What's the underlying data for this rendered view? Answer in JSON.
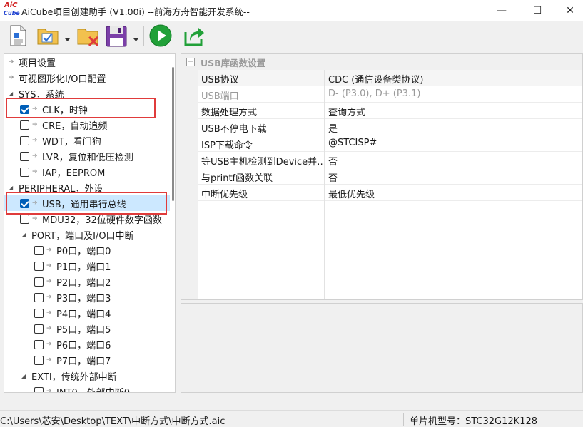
{
  "window": {
    "logo_top": "AiC",
    "logo_bottom": "Cube",
    "title": "AiCube项目创建助手 (V1.00i) --前海方舟智能开发系统--",
    "min_glyph": "—",
    "max_glyph": "☐",
    "close_glyph": "✕"
  },
  "toolbar": {
    "buttons": [
      "new-project",
      "open-config",
      "delete",
      "save",
      "run",
      "export"
    ]
  },
  "tree": {
    "items": [
      {
        "label": "项目设置"
      },
      {
        "label": "可视图形化I/O口配置"
      },
      {
        "label": "SYS，系统"
      },
      {
        "label": "CLK，时钟",
        "checked": true
      },
      {
        "label": "CRE，自动追频",
        "checked": false
      },
      {
        "label": "WDT，看门狗",
        "checked": false
      },
      {
        "label": "LVR，复位和低压检测",
        "checked": false
      },
      {
        "label": "IAP，EEPROM",
        "checked": false
      },
      {
        "label": "PERIPHERAL，外设"
      },
      {
        "label": "USB，通用串行总线",
        "checked": true
      },
      {
        "label": "MDU32，32位硬件数字函数",
        "checked": false
      },
      {
        "label": "PORT，端口及I/O口中断"
      },
      {
        "label": "P0口，端口0",
        "checked": false
      },
      {
        "label": "P1口，端口1",
        "checked": false
      },
      {
        "label": "P2口，端口2",
        "checked": false
      },
      {
        "label": "P3口，端口3",
        "checked": false
      },
      {
        "label": "P4口，端口4",
        "checked": false
      },
      {
        "label": "P5口，端口5",
        "checked": false
      },
      {
        "label": "P6口，端口6",
        "checked": false
      },
      {
        "label": "P7口，端口7",
        "checked": false
      },
      {
        "label": "EXTI，传统外部中断"
      },
      {
        "label": "INT0，外部中断0",
        "checked": false
      }
    ]
  },
  "props": {
    "category": "USB库函数设置",
    "rows": [
      {
        "key": "USB协议",
        "value": "CDC (通信设备类协议)"
      },
      {
        "key": "USB端口",
        "value": "D- (P3.0), D+ (P3.1)"
      },
      {
        "key": "数据处理方式",
        "value": "查询方式"
      },
      {
        "key": "USB不停电下载",
        "value": "是"
      },
      {
        "key": "ISP下载命令",
        "value": "@STCISP#"
      },
      {
        "key": "等USB主机检测到Device并…",
        "value": "否"
      },
      {
        "key": "与printf函数关联",
        "value": "否"
      },
      {
        "key": "中断优先级",
        "value": "最低优先级"
      }
    ]
  },
  "status": {
    "path": "C:\\Users\\芯安\\Desktop\\TEXT\\中断方式\\中断方式.aic",
    "chip": "单片机型号：STC32G12K128"
  }
}
